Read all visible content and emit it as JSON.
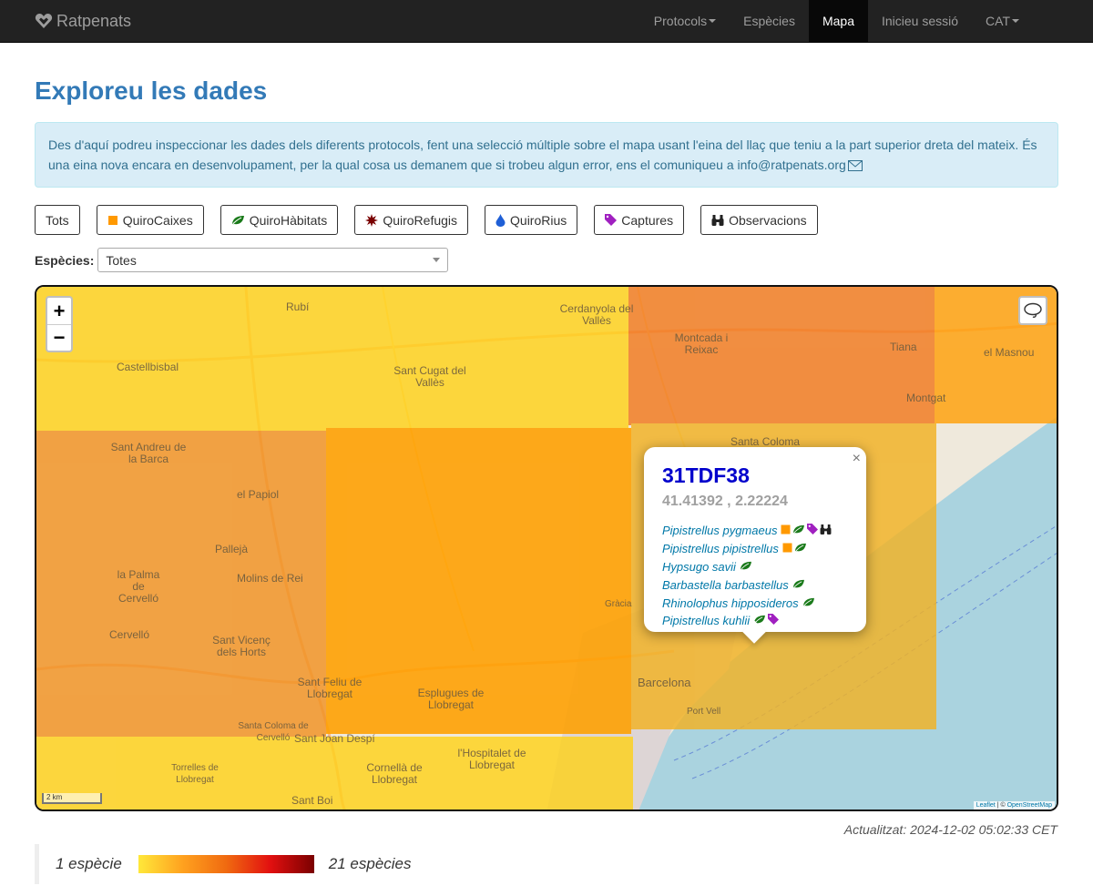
{
  "navbar": {
    "brand": "Ratpenats",
    "items": [
      {
        "label": "Protocols",
        "dropdown": true,
        "active": false
      },
      {
        "label": "Espècies",
        "dropdown": false,
        "active": false
      },
      {
        "label": "Mapa",
        "dropdown": false,
        "active": true
      },
      {
        "label": "Inicieu sessió",
        "dropdown": false,
        "active": false
      },
      {
        "label": "CAT",
        "dropdown": true,
        "active": false
      }
    ]
  },
  "page": {
    "title": "Exploreu les dades",
    "alert_text": "Des d'aquí podreu inspeccionar les dades dels diferents protocols, fent una selecció múltiple sobre el mapa usant l'eina del llaç que teniu a la part superior dreta del mateix. És una eina nova encara en desenvolupament, per la qual cosa us demanem que si trobeu algun error, ens el comuniqueu a ",
    "alert_email": "info@ratpenats.org"
  },
  "filters": {
    "buttons": [
      {
        "label": "Tots",
        "icon": "none"
      },
      {
        "label": "QuiroCaixes",
        "icon": "orange-square-icon",
        "color": "#ff9900"
      },
      {
        "label": "QuiroHàbitats",
        "icon": "green-leaf-icon",
        "color": "#1a7a1a"
      },
      {
        "label": "QuiroRefugis",
        "icon": "dark-red-burst-icon",
        "color": "#7a0000"
      },
      {
        "label": "QuiroRius",
        "icon": "blue-drop-icon",
        "color": "#1f5fd6"
      },
      {
        "label": "Captures",
        "icon": "purple-tag-icon",
        "color": "#a020c0"
      },
      {
        "label": "Observacions",
        "icon": "binoculars-icon",
        "color": "#222222"
      }
    ],
    "species_label": "Espècies:",
    "species_selected": "Totes"
  },
  "map": {
    "zoom_in": "+",
    "zoom_out": "−",
    "scale_label": "2 km",
    "attribution_leaflet": "Leaflet",
    "attribution_sep": " | © ",
    "attribution_osm": "OpenStreetMap",
    "places": [
      "Rubí",
      "Cerdanyola del Vallès",
      "Montcada i Reixac",
      "el Masnou",
      "Castellbisbal",
      "Sant Cugat del Vallès",
      "Tiana",
      "Montgat",
      "Santa Coloma",
      "Sant Andreu de la Barca",
      "el Papiol",
      "Pallejà",
      "la Palma de Cervelló",
      "Molins de Rei",
      "Cervelló",
      "Sant Vicenç dels Horts",
      "Sant Feliu de Llobregat",
      "Esplugues de Llobregat",
      "Barcelona",
      "Sant Joan Despí",
      "Santa Coloma de Cervelló",
      "l'Hospitalet de Llobregat",
      "Cornellà de Llobregat",
      "Torrelles de Llobregat",
      "Sant Boi",
      "Port Vell",
      "Gràcia"
    ],
    "grid_colors": {
      "low": "#ffd21a",
      "mid": "#ffa00a",
      "high": "#f27a1e",
      "ambre": "#f2b223"
    }
  },
  "popup": {
    "cell": "31TDF38",
    "coords": "41.41392 , 2.22224",
    "close": "×",
    "species": [
      {
        "name": "Pipistrellus pygmaeus",
        "icons": [
          "orange-square-icon",
          "green-leaf-icon",
          "purple-tag-icon",
          "binoculars-icon"
        ]
      },
      {
        "name": "Pipistrellus pipistrellus",
        "icons": [
          "orange-square-icon",
          "green-leaf-icon"
        ]
      },
      {
        "name": "Hypsugo savii",
        "icons": [
          "green-leaf-icon"
        ]
      },
      {
        "name": "Barbastella barbastellus",
        "icons": [
          "green-leaf-icon"
        ]
      },
      {
        "name": "Rhinolophus hipposideros",
        "icons": [
          "green-leaf-icon"
        ]
      },
      {
        "name": "Pipistrellus kuhlii",
        "icons": [
          "green-leaf-icon",
          "purple-tag-icon"
        ]
      }
    ]
  },
  "updated": "Actualitzat: 2024-12-02 05:02:33 CET",
  "legend": {
    "min_label": "1 espècie",
    "max_label": "21 espècies",
    "gradient_colors": [
      "#ffe83a",
      "#ffa21f",
      "#f06a10",
      "#e21010",
      "#7a0000"
    ]
  }
}
